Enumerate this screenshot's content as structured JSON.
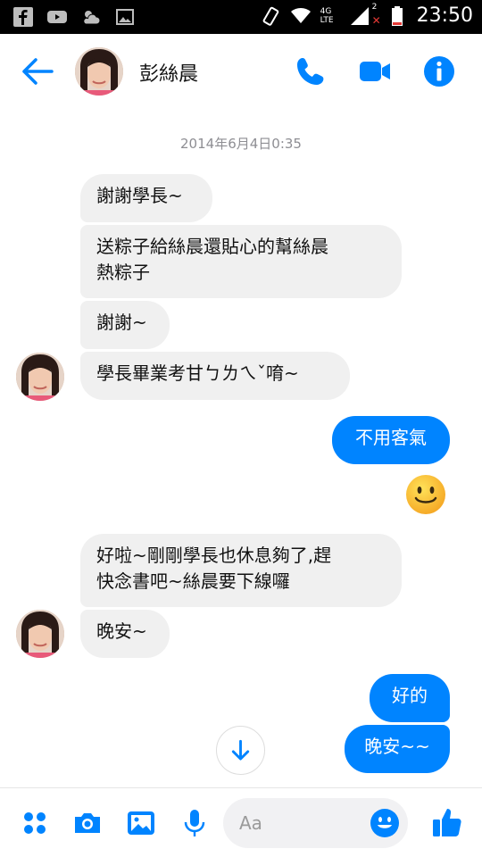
{
  "status_bar": {
    "time": "23:50",
    "icons": [
      "facebook-icon",
      "youtube-icon",
      "weather-icon",
      "image-icon",
      "vibrate-icon",
      "wifi-icon",
      "4g-lte-icon",
      "signal-icon",
      "battery-icon"
    ],
    "network": "4G LTE",
    "sim2_badge": "2"
  },
  "header": {
    "contact_name": "彭絲晨",
    "icons": [
      "back-arrow-icon",
      "phone-icon",
      "video-camera-icon",
      "info-icon"
    ],
    "accent_color": "#0084ff"
  },
  "thread": {
    "timestamp": "2014年6月4日0:35",
    "messages": [
      {
        "sender": "them",
        "text": "謝謝學長~"
      },
      {
        "sender": "them",
        "lines": [
          "送粽子給絲晨還貼心的幫絲晨",
          "熱粽子"
        ]
      },
      {
        "sender": "them",
        "text": "謝謝~"
      },
      {
        "sender": "them",
        "text": "學長畢業考甘ㄅㄌㄟˇ唷~"
      },
      {
        "sender": "me",
        "text": "不用客氣"
      },
      {
        "sender": "me",
        "emoji": "smiling-face-emoji"
      },
      {
        "sender": "them",
        "lines": [
          "好啦~剛剛學長也休息夠了,趕",
          "快念書吧~絲晨要下線囉"
        ]
      },
      {
        "sender": "them",
        "text": "晚安~"
      },
      {
        "sender": "me",
        "text": "好的"
      },
      {
        "sender": "me",
        "text": "晚安~~"
      }
    ],
    "incoming_bubble_color": "#f0f0f0",
    "outgoing_bubble_color": "#0084ff"
  },
  "composer": {
    "placeholder": "Aa",
    "icons": [
      "more-options-icon",
      "camera-icon",
      "gallery-icon",
      "microphone-icon",
      "emoji-icon",
      "thumbs-up-icon"
    ]
  }
}
